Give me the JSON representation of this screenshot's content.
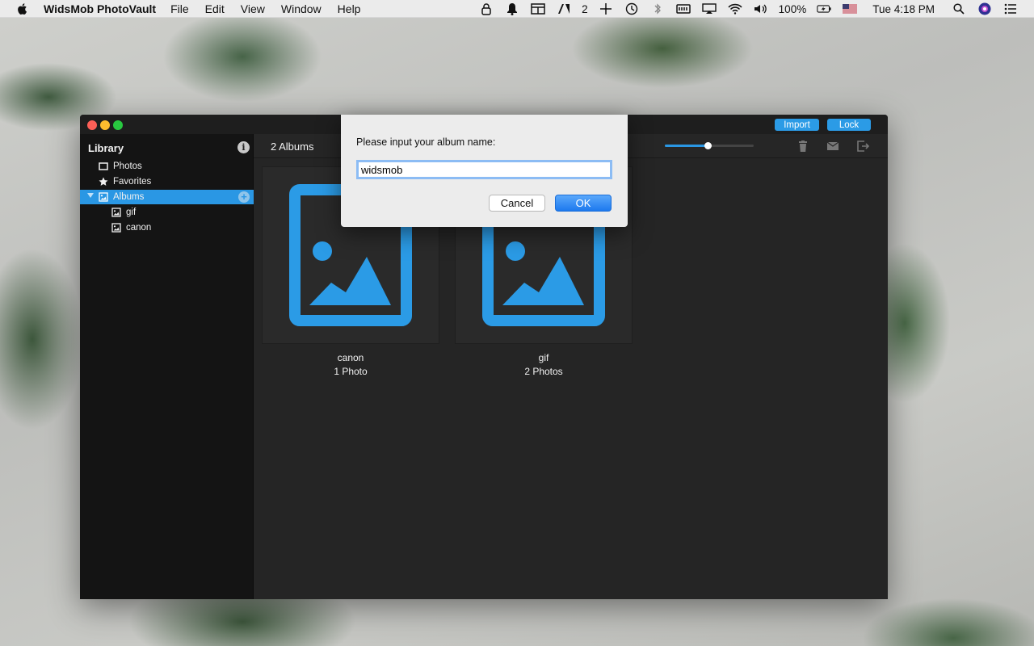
{
  "menubar": {
    "app_name": "WidsMob PhotoVault",
    "items": [
      "File",
      "Edit",
      "View",
      "Window",
      "Help"
    ],
    "tray": {
      "adobe_count": "2",
      "battery": "100%",
      "clock": "Tue 4:18 PM"
    }
  },
  "window": {
    "import_label": "Import",
    "lock_label": "Lock"
  },
  "sidebar": {
    "title": "Library",
    "info_glyph": "i",
    "items": {
      "photos": "Photos",
      "favorites": "Favorites",
      "albums": "Albums",
      "gif": "gif",
      "canon": "canon"
    },
    "add_glyph": "+"
  },
  "toolbar": {
    "album_count": "2 Albums",
    "zoom_level": 0.48
  },
  "albums": [
    {
      "name": "canon",
      "count": "1 Photo"
    },
    {
      "name": "gif",
      "count": "2 Photos"
    }
  ],
  "dialog": {
    "prompt": "Please input your album name:",
    "input_value": "widsmob",
    "cancel_label": "Cancel",
    "ok_label": "OK"
  },
  "colors": {
    "accent": "#2a97e4",
    "album_icon": "#2b9be6"
  }
}
